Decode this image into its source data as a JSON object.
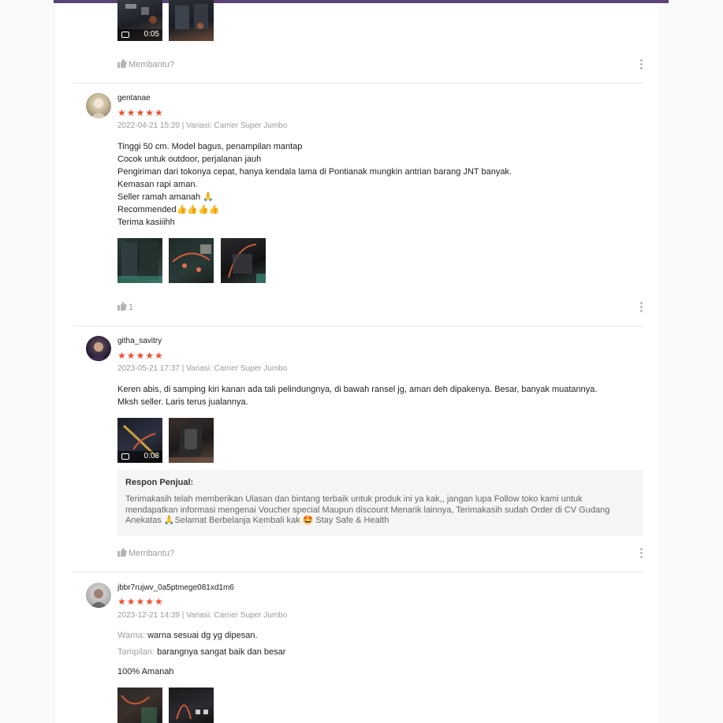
{
  "reviews": [
    {
      "helpful_label": "Membantu?",
      "video_duration": "0:05"
    },
    {
      "username": "gentanae",
      "stars": "★★★★★",
      "meta": "2022-04-21 15:20 | Variasi: Carrier Super Jumbo",
      "lines": [
        "Tinggi 50 cm. Model bagus, penampilan mantap",
        "Cocok untuk outdoor, perjalanan jauh",
        "Pengiriman dari tokonya cepat, hanya kendala lama di Pontianak mungkin antrian barang JNT banyak.",
        "Kemasan rapi aman.",
        "Seller ramah amanah 🙏",
        "Recommended👍👍👍👍",
        "Terima kasiiihh"
      ],
      "helpful_label": "1"
    },
    {
      "username": "githa_savitry",
      "stars": "★★★★★",
      "meta": "2023-05-21 17:37 | Variasi: Carrier Super Jumbo",
      "lines": [
        "Keren abis, di samping kiri kanan ada tali pelindungnya, di bawah ransel jg, aman deh dipakenya. Besar, banyak muatannya.",
        "Mksh seller. Laris terus jualannya."
      ],
      "video_duration": "0:08",
      "seller_response": {
        "title": "Respon Penjual:",
        "text": "Terimakasih telah memberikan Ulasan dan bintang terbaik untuk produk ini ya kak,, jangan lupa Follow toko kami untuk mendapatkan informasi mengenai Voucher special Maupun discount Menarik lainnya, Terimakasih sudah Order di CV Gudang Anekatas 🙏Selamat Berbelanja Kembali kak 🤩 Stay Safe & Health"
      },
      "helpful_label": "Membantu?"
    },
    {
      "username": "jbbr7rujwv_0a5ptmege081xd1m6",
      "stars": "★★★★★",
      "meta": "2023-12-21 14:39 | Variasi: Carrier Super Jumbo",
      "attr1_label": "Warna:",
      "attr1_value": "warna sesuai dg yg dipesan.",
      "attr2_label": "Tampilan:",
      "attr2_value": "barangnya sangat baik dan besar",
      "extra_line": "100% Amanah"
    }
  ],
  "colors": {
    "accent_bar": "#5c4275",
    "star": "#ee4d2d",
    "muted_text": "#9b9b9b",
    "response_bg": "#f5f5f5"
  }
}
